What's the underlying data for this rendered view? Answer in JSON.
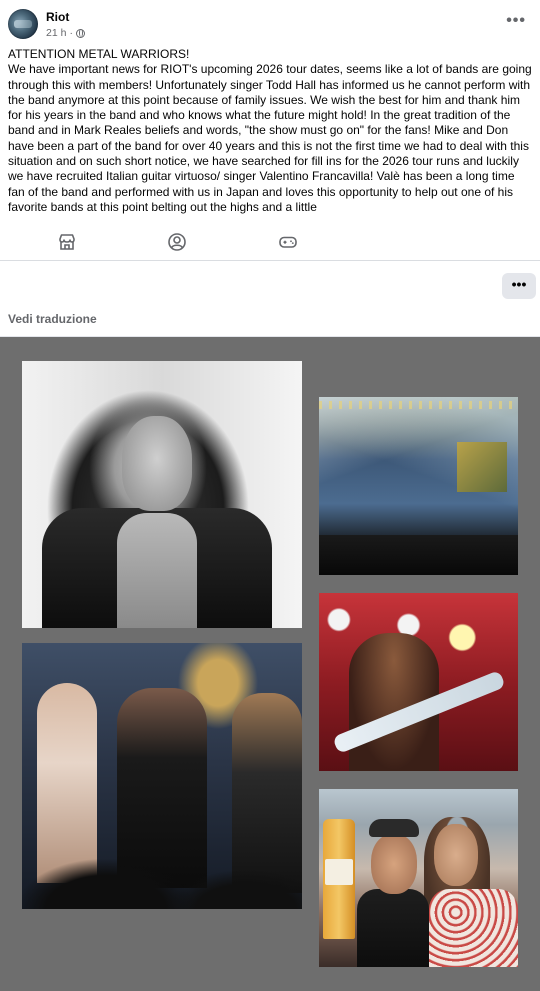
{
  "header": {
    "page_name": "Riot",
    "time": "21 h",
    "separator": "·"
  },
  "post": {
    "paragraphs": [
      "ATTENTION METAL WARRIORS!",
      "We have important news for RIOT's upcoming 2026 tour dates, seems like a lot of bands are going through this with members! Unfortunately singer Todd Hall has informed us he cannot perform with the band anymore at this point because of family issues. We wish the best for him and thank him for his years in the band and who knows what the future might hold! In the great tradition of the band and in Mark Reales beliefs and words, \"the show must go on\" for the fans! Mike and Don have been a part of the band for over 40 years and this is not the first time we had to deal with this situation and on such short notice, we have searched for fill ins for the 2026 tour runs and luckily we have recruited Italian guitar virtuoso/ singer Valentino Francavilla! Valè has been a long time fan of the band and performed with us in Japan and loves this opportunity to help out one of his favorite bands at this point belting out the highs and a little"
    ]
  },
  "actions": {
    "icons": [
      "store-icon",
      "profile-icon",
      "gamepad-icon"
    ]
  },
  "more_button": "•••",
  "more_top": "•••",
  "translate": "Vedi traduzione",
  "gallery": {
    "photo_count": 5
  }
}
